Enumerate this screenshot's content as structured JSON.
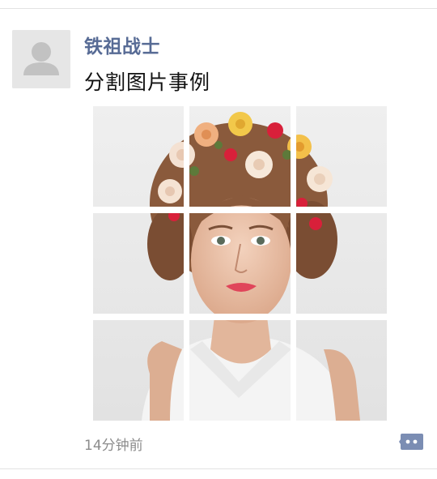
{
  "post": {
    "username": "铁祖战士",
    "text": "分割图片事例",
    "timestamp": "14分钟前",
    "image_grid": {
      "rows": 3,
      "columns": 3
    }
  },
  "colors": {
    "username": "#576b95",
    "text": "#111111",
    "timestamp": "#8c8c8c",
    "comment_icon": "#7b8db3"
  },
  "icons": {
    "avatar": "default-user-icon",
    "comment": "comment-bubble-icon"
  }
}
